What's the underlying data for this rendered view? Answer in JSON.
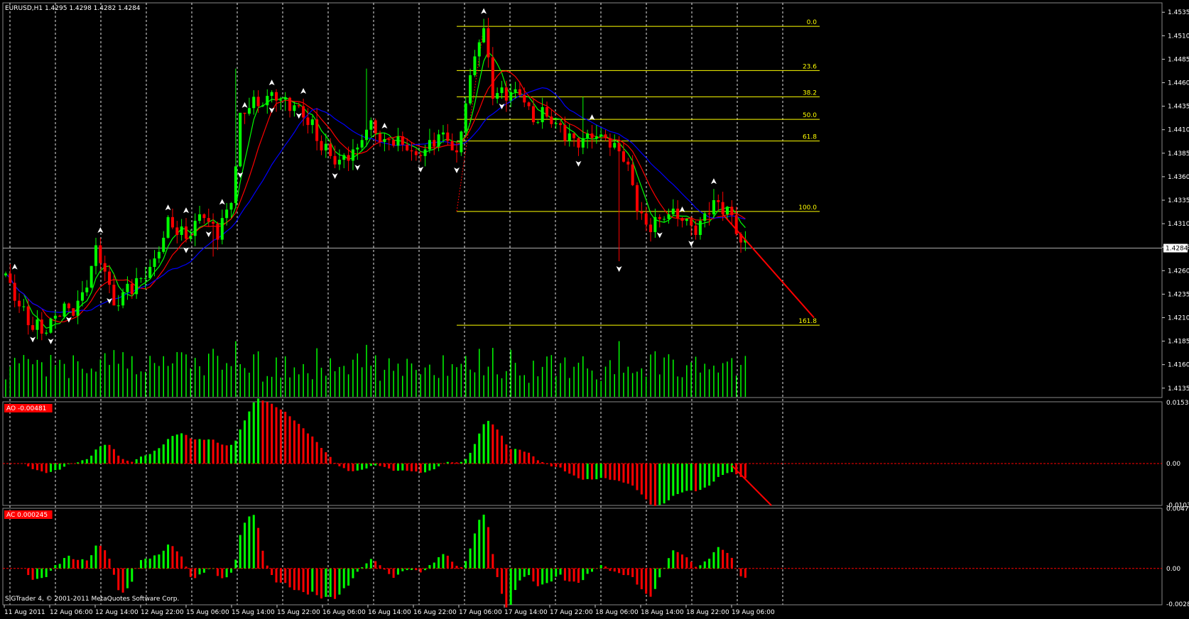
{
  "chart_data": [
    {
      "type": "candlestick",
      "title": "EURUSD,H1  1.4295 1.4298 1.4282 1.4284",
      "symbol_header": "EURUSD,H1",
      "ohlc_header": "1.4295 1.4298 1.4282 1.4284",
      "ylim": [
        1.4125,
        1.4545
      ],
      "y_ticks": [
        "1.4535",
        "1.4510",
        "1.4485",
        "1.4460",
        "1.4435",
        "1.4410",
        "1.4385",
        "1.4360",
        "1.4335",
        "1.4310",
        "1.4285",
        "1.4260",
        "1.4235",
        "1.4210",
        "1.4185",
        "1.4160",
        "1.4135"
      ],
      "current_price": "1.4284",
      "x_labels": [
        "11 Aug 2011",
        "12 Aug 06:00",
        "12 Aug 14:00",
        "12 Aug 22:00",
        "15 Aug 06:00",
        "15 Aug 14:00",
        "15 Aug 22:00",
        "16 Aug 06:00",
        "16 Aug 14:00",
        "16 Aug 22:00",
        "17 Aug 06:00",
        "17 Aug 14:00",
        "17 Aug 22:00",
        "18 Aug 06:00",
        "18 Aug 14:00",
        "18 Aug 22:00",
        "19 Aug 06:00"
      ],
      "fibonacci": {
        "levels": [
          {
            "label": "0.0",
            "price": 1.452
          },
          {
            "label": "23.6",
            "price": 1.4473
          },
          {
            "label": "38.2",
            "price": 1.4445
          },
          {
            "label": "50.0",
            "price": 1.4421
          },
          {
            "label": "61.8",
            "price": 1.4398
          },
          {
            "label": "100.0",
            "price": 1.4323
          },
          {
            "label": "161.8",
            "price": 1.4202
          }
        ]
      },
      "moving_averages": [
        {
          "color": "#00ff00",
          "role": "fast"
        },
        {
          "color": "#ff0000",
          "role": "medium"
        },
        {
          "color": "#0000ff",
          "role": "slow"
        }
      ],
      "candles": [],
      "volume": []
    },
    {
      "type": "bar",
      "title": "AO -0.00481",
      "label": "AO -0.00481",
      "ylim": [
        -0.0105,
        0.0155
      ],
      "y_ticks": [
        "0.0153",
        "0.00",
        "-0.01038"
      ],
      "values": []
    },
    {
      "type": "bar",
      "title": "AC 0.000245",
      "label": "AC 0.000245",
      "ylim": [
        -0.0029,
        0.0048
      ],
      "y_ticks": [
        "0.00476",
        "0.00",
        "-0.00284"
      ],
      "values": []
    }
  ],
  "colors": {
    "background": "#000000",
    "grid": "#ffffff",
    "bull": "#00ff00",
    "bear": "#ff0000",
    "fib": "#ffff00",
    "volume": "#00ff00",
    "text": "#ffffff",
    "ao_label_bg": "#ff0000",
    "arrow": "#ffffff"
  },
  "footer": "SIGTrader 4, © 2001-2011 MetaQuotes Software Corp."
}
